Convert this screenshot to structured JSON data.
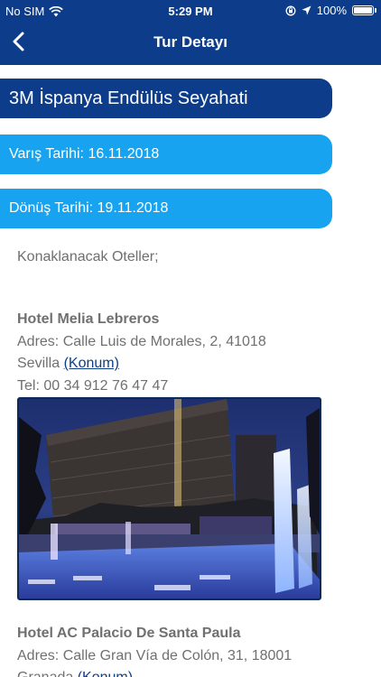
{
  "status_bar": {
    "carrier": "No SIM",
    "time": "5:29 PM",
    "battery": "100%",
    "battery_level": 1.0
  },
  "nav": {
    "title": "Tur Detayı",
    "back_icon": "chevron-left-icon"
  },
  "tour": {
    "title": "3M İspanya Endülüs Seyahati",
    "start_date": "Varış Tarihi: 16.11.2018",
    "end_date": "Dönüş Tarihi: 19.11.2018"
  },
  "section_label": "Konaklanacak Oteller;",
  "hotels": [
    {
      "name": "Hotel Melia Lebreros",
      "address_line1": "Adres: Calle Luis de Morales, 2, 41018",
      "address_city": "Sevilla",
      "location_link": "(Konum)",
      "phone": "Tel: 00 34 912 76 47 47"
    },
    {
      "name": "Hotel AC Palacio De Santa Paula",
      "address_line1": "Adres: Calle Gran Vía de Colón, 31, 18001",
      "address_city": "Granada",
      "location_link": "(Konum)"
    }
  ],
  "colors": {
    "brand_navy": "#0d3d8a",
    "accent_blue": "#18a3f0",
    "body_text": "#707070"
  }
}
